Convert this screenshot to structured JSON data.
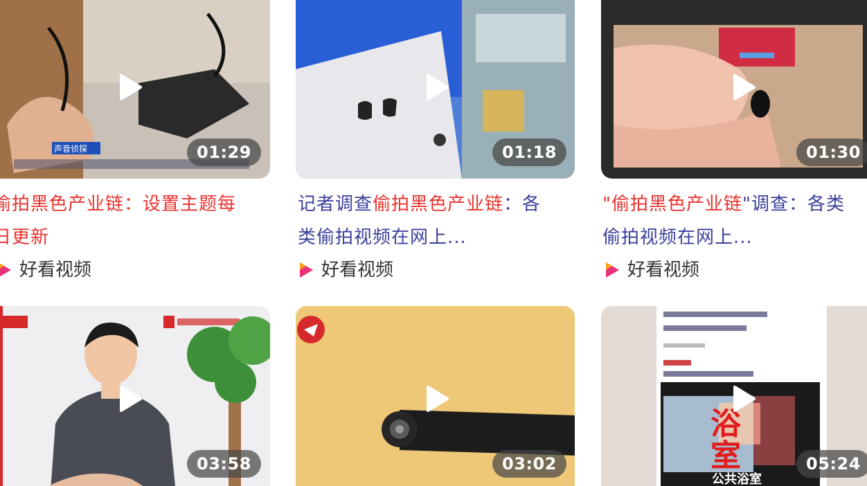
{
  "videos": [
    {
      "duration": "01:29",
      "title_line1_parts": [
        "偷拍黑色产业链：设置主题每",
        ""
      ],
      "title_line2": "日更新",
      "source": "好看视频",
      "thumb_caption": "声音侦探",
      "colors": {
        "title": "#e8322e"
      }
    },
    {
      "duration": "01:18",
      "title_prefix": "记者调查",
      "title_highlight": "偷拍黑色产业链",
      "title_suffix": "：各",
      "title_line2": "类偷拍视频在网上...",
      "source": "好看视频"
    },
    {
      "duration": "01:30",
      "title_prefix": "\"",
      "title_highlight": "偷拍黑色产业链",
      "title_suffix": "\"调查：各类",
      "title_line2": "偷拍视频在网上...",
      "source": "好看视频"
    },
    {
      "duration": "03:58"
    },
    {
      "duration": "03:02"
    },
    {
      "duration": "05:24",
      "thumb_text_big": "浴室",
      "thumb_text_small": "公共浴室"
    }
  ],
  "colors": {
    "title_blue": "#3a3f9a",
    "title_red": "#e8322e",
    "source_logo": "#e8327a"
  }
}
